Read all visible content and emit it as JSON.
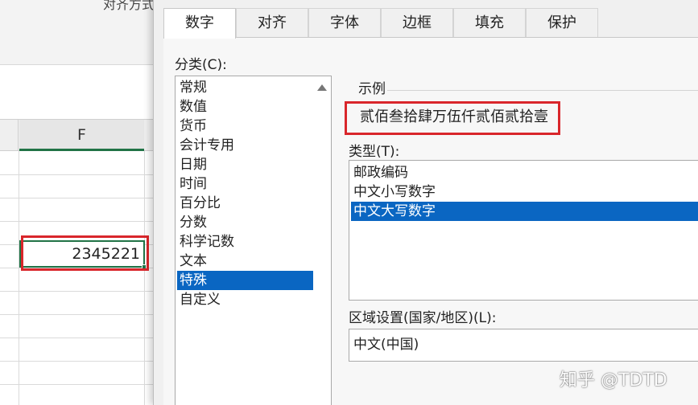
{
  "excel": {
    "ribbon_label": "对齐方式",
    "column_header": "F",
    "cell_value": "2345221"
  },
  "dialog": {
    "tabs": [
      "数字",
      "对齐",
      "字体",
      "边框",
      "填充",
      "保护"
    ],
    "active_tab": "数字",
    "category_label": "分类(C):",
    "category_label_key": "C",
    "categories": [
      "常规",
      "数值",
      "货币",
      "会计专用",
      "日期",
      "时间",
      "百分比",
      "分数",
      "科学记数",
      "文本",
      "特殊",
      "自定义"
    ],
    "selected_category": "特殊",
    "sample_label": "示例",
    "sample_value": "贰佰叁拾肆万伍仟贰佰贰拾壹",
    "type_label": "类型(T):",
    "types": [
      "邮政编码",
      "中文小写数字",
      "中文大写数字"
    ],
    "selected_type": "中文大写数字",
    "locale_label": "区域设置(国家/地区)(L):",
    "locale_value": "中文(中国)"
  },
  "watermark": "知乎 @TDTD",
  "colors": {
    "selection": "#0a66c2",
    "highlight_border": "#d9262b",
    "excel_green": "#217346"
  }
}
